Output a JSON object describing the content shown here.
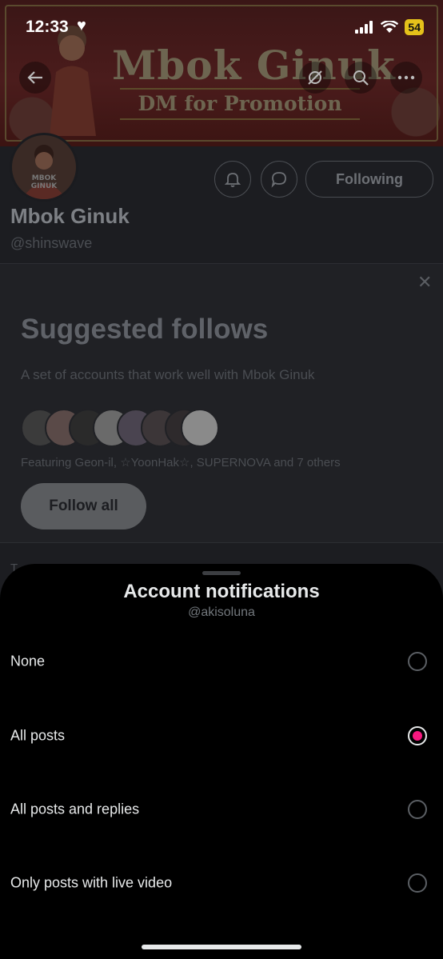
{
  "status_bar": {
    "time": "12:33",
    "battery": "54"
  },
  "banner": {
    "title": "Mbok Ginuk",
    "subtitle": "DM for Promotion"
  },
  "avatar_text": [
    "MBOK",
    "GINUK"
  ],
  "profile": {
    "name": "Mbok Ginuk",
    "handle": "@shinswave",
    "following_label": "Following"
  },
  "suggested": {
    "title": "Suggested follows",
    "description": "A set of accounts that work well with Mbok Ginuk",
    "featuring": "Featuring Geon-il, ☆YoonHak☆, SUPERNOVA and 7 others",
    "follow_all_label": "Follow all",
    "avatar_colors": [
      "#3b3b3b",
      "#5a4a48",
      "#2a2a2a",
      "#6a6a6a",
      "#4a4450",
      "#3c3638",
      "#2e2a2c",
      "#8a8a8a"
    ]
  },
  "partial_tab_text": "T",
  "sheet": {
    "title": "Account notifications",
    "subtitle": "@akisoluna",
    "options": [
      {
        "label": "None",
        "selected": false
      },
      {
        "label": "All posts",
        "selected": true
      },
      {
        "label": "All posts and replies",
        "selected": false
      },
      {
        "label": "Only posts with live video",
        "selected": false
      }
    ]
  },
  "colors": {
    "accent": "#f91880",
    "sheet_bg": "#000000",
    "dim_bg": "#1c1d21"
  }
}
